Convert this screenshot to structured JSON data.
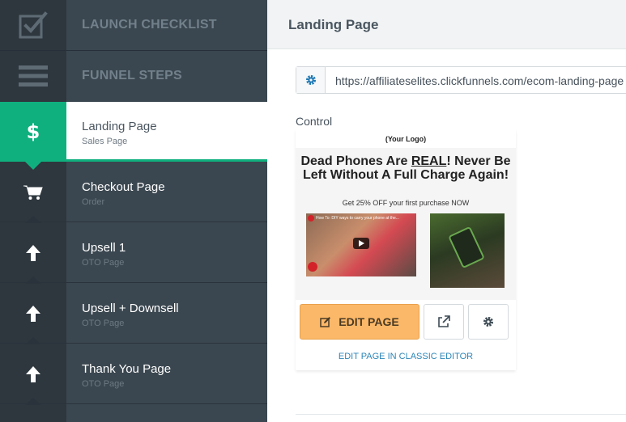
{
  "sidebar": {
    "launch_checklist": "LAUNCH CHECKLIST",
    "funnel_steps": "FUNNEL STEPS",
    "steps": [
      {
        "title": "Landing Page",
        "subtitle": "Sales Page",
        "icon": "dollar-icon"
      },
      {
        "title": "Checkout Page",
        "subtitle": "Order",
        "icon": "cart-icon"
      },
      {
        "title": "Upsell 1",
        "subtitle": "OTO Page",
        "icon": "arrow-up-icon"
      },
      {
        "title": "Upsell + Downsell",
        "subtitle": "OTO Page",
        "icon": "arrow-up-icon"
      },
      {
        "title": "Thank You Page",
        "subtitle": "OTO Page",
        "icon": "arrow-up-icon"
      }
    ]
  },
  "header": {
    "title": "Landing Page"
  },
  "url": {
    "value": "https://affiliateselites.clickfunnels.com/ecom-landing-page"
  },
  "variant": {
    "label": "Control",
    "preview": {
      "logo": "(Your Logo)",
      "headline_a": "Dead Phones Are ",
      "headline_u": "REAL",
      "headline_b": "! Never Be Left Without A Full Charge Again!",
      "subhead": "Get 25% OFF your first purchase NOW",
      "video_title": "How To: DIY ways to carry your phone at the..."
    },
    "edit_label": "EDIT PAGE",
    "classic_label": "EDIT PAGE IN CLASSIC EDITOR"
  },
  "colors": {
    "accent": "#10b07e",
    "edit": "#fbb868",
    "link": "#2d86b8"
  }
}
